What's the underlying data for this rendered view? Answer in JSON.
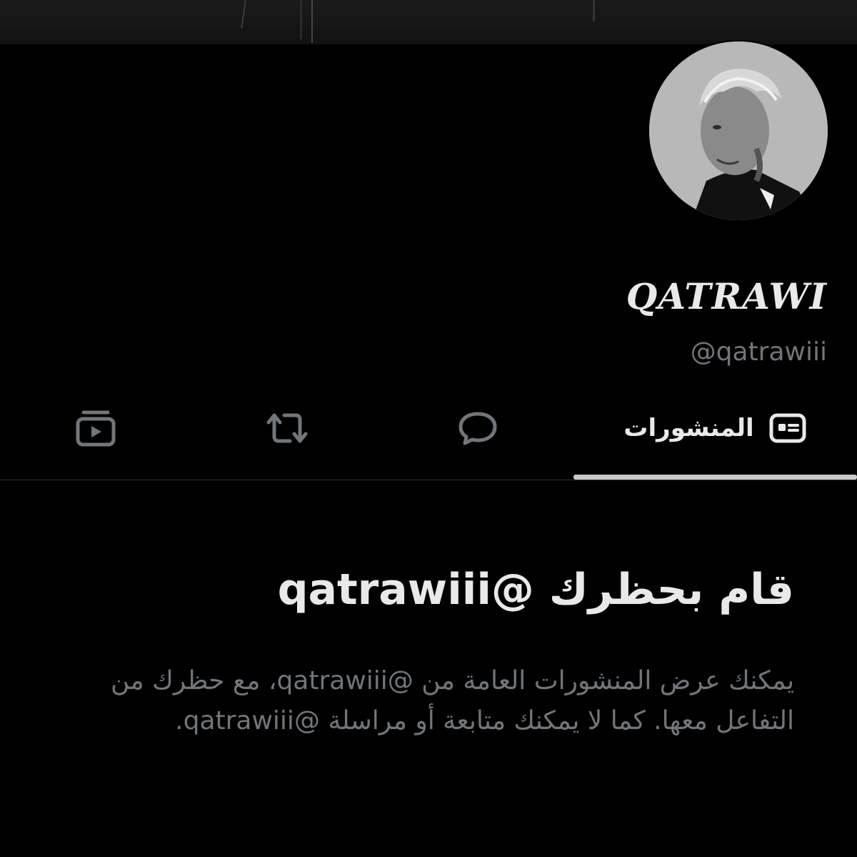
{
  "profile": {
    "display_name": "QATRAWI",
    "handle": "@qatrawiii",
    "avatar_icon": "profile-photo",
    "banner_icon": "header-image"
  },
  "tabs": [
    {
      "label": "المنشورات",
      "icon": "posts-icon",
      "active": true
    },
    {
      "label": "",
      "icon": "replies-icon",
      "active": false
    },
    {
      "label": "",
      "icon": "repost-icon",
      "active": false
    },
    {
      "label": "",
      "icon": "media-icon",
      "active": false
    }
  ],
  "blocked": {
    "title": "قام بحظرك @qatrawiii",
    "body": "يمكنك عرض المنشورات العامة من @qatrawiii، مع حظرك من التفاعل معها. كما لا يمكنك متابعة أو مراسلة @qatrawiii."
  },
  "colors": {
    "background": "#000000",
    "text_primary": "#e7e9ea",
    "text_secondary": "#71767b",
    "divider": "#2f3336",
    "active_underline": "#c9cacb"
  }
}
